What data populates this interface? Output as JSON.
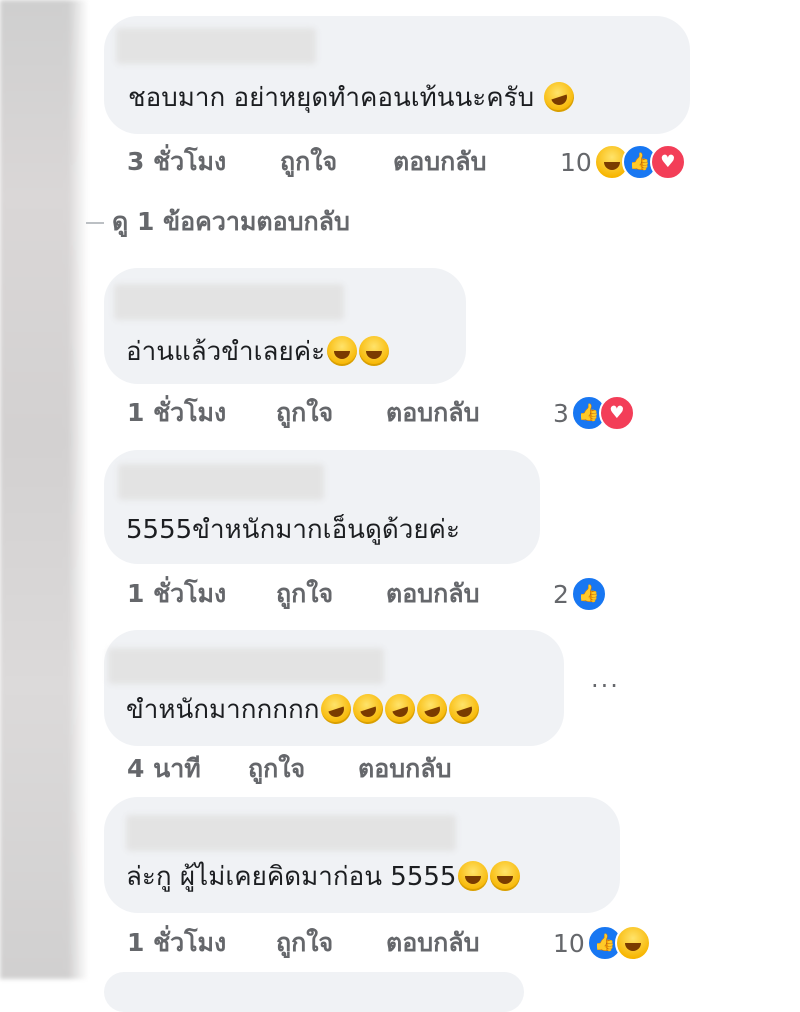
{
  "comments": [
    {
      "text": "ชอบมาก อย่าหยุดทำคอนเท้นนะครับ",
      "emojis": [
        "rolling-on-floor-laughing"
      ],
      "time": "3 ชั่วโมง",
      "like": "ถูกใจ",
      "reply": "ตอบกลับ",
      "reaction_count": "10",
      "reactions": [
        "haha",
        "like",
        "love"
      ]
    },
    {
      "text": "อ่านแล้วขำเลยค่ะ",
      "emojis": [
        "tears-of-joy",
        "tears-of-joy"
      ],
      "time": "1 ชั่วโมง",
      "like": "ถูกใจ",
      "reply": "ตอบกลับ",
      "reaction_count": "3",
      "reactions": [
        "like",
        "love"
      ]
    },
    {
      "text": "5555ขำหนักมากเอ็นดูด้วยค่ะ",
      "emojis": [],
      "time": "1 ชั่วโมง",
      "like": "ถูกใจ",
      "reply": "ตอบกลับ",
      "reaction_count": "2",
      "reactions": [
        "like"
      ]
    },
    {
      "text": "ขำหนักมากกกกก",
      "emojis": [
        "rolling-on-floor-laughing",
        "rolling-on-floor-laughing",
        "rolling-on-floor-laughing",
        "rolling-on-floor-laughing",
        "rolling-on-floor-laughing"
      ],
      "time": "4 นาที",
      "like": "ถูกใจ",
      "reply": "ตอบกลับ",
      "reaction_count": "",
      "reactions": []
    },
    {
      "text": "ล่ะกู ผู้ไม่เคยคิดมาก่อน 5555",
      "emojis": [
        "grinning-sweat",
        "grinning-sweat"
      ],
      "time": "1 ชั่วโมง",
      "like": "ถูกใจ",
      "reply": "ตอบกลับ",
      "reaction_count": "10",
      "reactions": [
        "like",
        "haha"
      ]
    }
  ],
  "view_replies_label": "ดู 1 ข้อความตอบกลับ",
  "more_options": "···",
  "colors": {
    "bubble": "#f0f2f5",
    "meta_text": "#65676b",
    "like": "#1877f2",
    "love": "#f33e58",
    "haha": "#f7b500"
  }
}
